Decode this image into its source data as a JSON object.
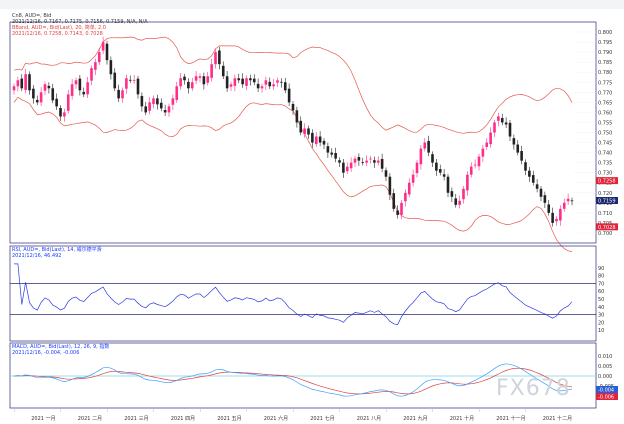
{
  "header": {
    "title": "",
    "window_title_right": ""
  },
  "panels": {
    "price": {
      "lines": [
        {
          "text": "Cn8, AUD=, Bid",
          "color": "#333333"
        },
        {
          "text": "2021/12/16, 0.7167, 0.7175, 0.7156, 0.7159, N/A, N/A",
          "color": "#333333"
        },
        {
          "text": "BBand, AUD=, Bid(Last), 20, 简单, 2.0",
          "color": "#e04040"
        },
        {
          "text": "2021/12/16, 0.7258, 0.7143, 0.7028",
          "color": "#e04040"
        }
      ],
      "tags": [
        {
          "text": "0.7159",
          "color": "#1a2a6e",
          "price": 0.7159
        },
        {
          "text": "0.7258",
          "color": "#e0243a",
          "price": 0.7258
        },
        {
          "text": "0.7028",
          "color": "#e0243a",
          "price": 0.7028
        }
      ]
    },
    "rsi": {
      "lines": [
        {
          "text": "RSI, AUD=, Bid(Last), 14, 威尔德平滑",
          "color": "#1a3cff"
        },
        {
          "text": "2021/12/16, 46.492",
          "color": "#1a3cff"
        }
      ]
    },
    "macd": {
      "lines": [
        {
          "text": "MACD, AUD=, Bid(Last), 12, 26, 9, 指数",
          "color": "#1a3cff"
        },
        {
          "text": "2021/12/16, -0.004, -0.006",
          "color": "#1a3cff"
        }
      ],
      "tags": [
        {
          "text": "-0.004",
          "color": "#2a5bd8"
        },
        {
          "text": "-0.006",
          "color": "#e0243a"
        }
      ]
    }
  },
  "watermark": "FX678",
  "chart_data": [
    {
      "type": "candlestick",
      "title": "Cn8, AUD=, Bid",
      "ylim": [
        0.695,
        0.805
      ],
      "ticks": [
        0.8,
        0.795,
        0.79,
        0.785,
        0.78,
        0.775,
        0.77,
        0.765,
        0.76,
        0.755,
        0.75,
        0.745,
        0.74,
        0.735,
        0.73,
        0.725,
        0.72,
        0.715,
        0.71,
        0.705,
        0.7
      ],
      "close": [
        0.773,
        0.776,
        0.772,
        0.779,
        0.771,
        0.767,
        0.765,
        0.77,
        0.774,
        0.772,
        0.766,
        0.763,
        0.758,
        0.76,
        0.769,
        0.774,
        0.776,
        0.771,
        0.769,
        0.775,
        0.782,
        0.785,
        0.79,
        0.795,
        0.786,
        0.779,
        0.772,
        0.767,
        0.771,
        0.777,
        0.776,
        0.776,
        0.769,
        0.763,
        0.76,
        0.765,
        0.767,
        0.764,
        0.762,
        0.76,
        0.763,
        0.767,
        0.773,
        0.777,
        0.776,
        0.772,
        0.775,
        0.778,
        0.778,
        0.774,
        0.778,
        0.784,
        0.79,
        0.784,
        0.778,
        0.772,
        0.774,
        0.777,
        0.776,
        0.774,
        0.777,
        0.776,
        0.775,
        0.772,
        0.773,
        0.776,
        0.773,
        0.774,
        0.776,
        0.775,
        0.771,
        0.765,
        0.761,
        0.755,
        0.75,
        0.752,
        0.749,
        0.745,
        0.748,
        0.745,
        0.744,
        0.74,
        0.739,
        0.737,
        0.735,
        0.73,
        0.733,
        0.735,
        0.737,
        0.736,
        0.735,
        0.736,
        0.737,
        0.735,
        0.736,
        0.732,
        0.728,
        0.719,
        0.712,
        0.709,
        0.715,
        0.72,
        0.725,
        0.729,
        0.735,
        0.742,
        0.745,
        0.74,
        0.735,
        0.731,
        0.73,
        0.728,
        0.72,
        0.718,
        0.714,
        0.716,
        0.722,
        0.729,
        0.733,
        0.734,
        0.738,
        0.742,
        0.745,
        0.75,
        0.755,
        0.758,
        0.755,
        0.754,
        0.748,
        0.744,
        0.74,
        0.736,
        0.731,
        0.728,
        0.725,
        0.722,
        0.718,
        0.715,
        0.71,
        0.705,
        0.707,
        0.712,
        0.715,
        0.717,
        0.716
      ],
      "bollinger": {
        "upper": 0.7258,
        "middle": 0.7143,
        "lower": 0.7028,
        "period": 20,
        "stdev": 2.0
      },
      "last": {
        "date": "2021/12/16",
        "open": 0.7167,
        "high": 0.7175,
        "low": 0.7156,
        "close": 0.7159
      }
    },
    {
      "type": "line",
      "title": "RSI, AUD=, Bid(Last), 14",
      "ylim": [
        0,
        100
      ],
      "ticks": [
        90,
        80,
        70,
        60,
        50,
        40,
        30,
        20,
        10
      ],
      "reference_lines": [
        70,
        30
      ],
      "last": 46.492
    },
    {
      "type": "line",
      "title": "MACD, AUD=, Bid(Last), 12, 26, 9",
      "ylim": [
        -0.015,
        0.015
      ],
      "ticks": [
        0.01,
        0.005,
        0.0,
        -0.005,
        -0.01
      ],
      "series": [
        {
          "name": "MACD",
          "color": "#3aa0ff",
          "last": -0.004
        },
        {
          "name": "Signal",
          "color": "#e04040",
          "last": -0.006
        }
      ]
    }
  ],
  "x_axis": {
    "months": [
      "2021 一月",
      "2021 二月",
      "2021 三月",
      "2021 四月",
      "2021 五月",
      "2021 六月",
      "2021 七月",
      "2021 八月",
      "2021 九月",
      "2021 十月",
      "2021 十一月",
      "2021 十二月"
    ]
  },
  "colors": {
    "up": "#ff2d8a",
    "down": "#222222",
    "bands": "#e8584f",
    "rsi": "#2b3ce0",
    "macd": "#3aa0ff",
    "signal": "#e04040",
    "frame": "#2a2a78"
  }
}
